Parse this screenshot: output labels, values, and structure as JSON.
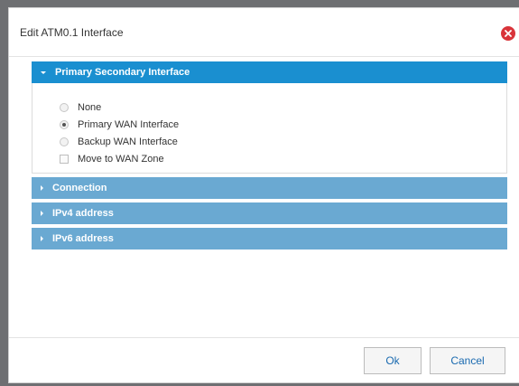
{
  "dialog": {
    "title": "Edit ATM0.1 Interface",
    "close_icon": "close-circle-icon"
  },
  "sections": [
    {
      "label": "Primary Secondary Interface",
      "expanded": true,
      "options": [
        {
          "label": "None",
          "type": "radio",
          "checked": false
        },
        {
          "label": "Primary WAN Interface",
          "type": "radio",
          "checked": true
        },
        {
          "label": "Backup WAN Interface",
          "type": "radio",
          "checked": false
        },
        {
          "label": "Move to WAN Zone",
          "type": "checkbox",
          "checked": false
        }
      ]
    },
    {
      "label": "Connection",
      "expanded": false
    },
    {
      "label": "IPv4 address",
      "expanded": false
    },
    {
      "label": "IPv6 address",
      "expanded": false
    }
  ],
  "footer": {
    "ok_label": "Ok",
    "cancel_label": "Cancel"
  },
  "colors": {
    "active_header": "#1a8fd0",
    "collapsed_header": "#6aa9d2",
    "close_button": "#d9343a",
    "button_text": "#1a6ab0"
  }
}
